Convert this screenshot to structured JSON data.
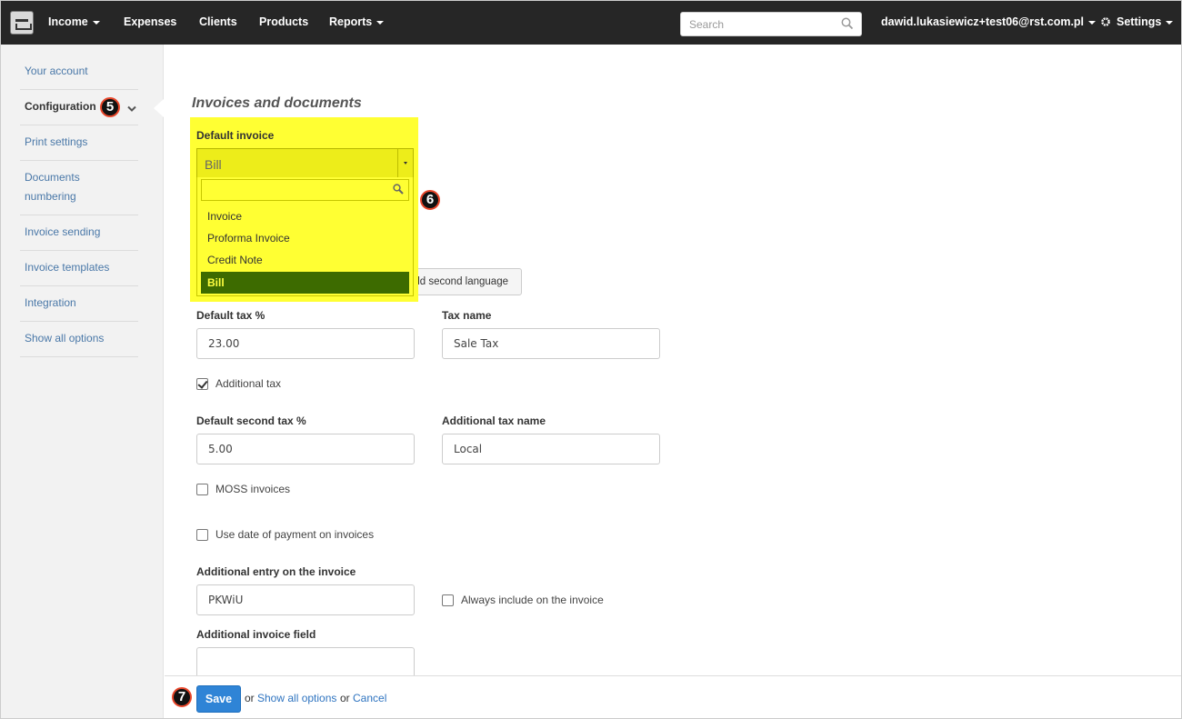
{
  "topnav": {
    "items": [
      {
        "label": "Income",
        "dropdown": true
      },
      {
        "label": "Expenses",
        "dropdown": false
      },
      {
        "label": "Clients",
        "dropdown": false
      },
      {
        "label": "Products",
        "dropdown": false
      },
      {
        "label": "Reports",
        "dropdown": true
      }
    ],
    "search_placeholder": "Search",
    "user_email": "dawid.lukasiewicz+test06@rst.com.pl",
    "settings_label": "Settings"
  },
  "sidebar": {
    "items": [
      {
        "label": "Your account"
      },
      {
        "label": "Configuration"
      },
      {
        "label": "Print settings"
      },
      {
        "label": "Documents numbering"
      },
      {
        "label": "Invoice sending"
      },
      {
        "label": "Invoice templates"
      },
      {
        "label": "Integration"
      },
      {
        "label": "Show all options"
      }
    ],
    "active": "Configuration"
  },
  "badges": {
    "five": "5",
    "six": "6",
    "seven": "7"
  },
  "main": {
    "section_title": "Invoices and documents",
    "default_invoice": {
      "label": "Default invoice",
      "selected": "Bill",
      "options": [
        "Invoice",
        "Proforma Invoice",
        "Credit Note",
        "Bill"
      ]
    },
    "add_language_label": "Add second language",
    "default_tax": {
      "label": "Default tax %",
      "value": "23.00"
    },
    "tax_name": {
      "label": "Tax name",
      "value": "Sale Tax"
    },
    "additional_tax": {
      "label": "Additional tax",
      "checked": true
    },
    "default_second_tax": {
      "label": "Default second tax %",
      "value": "5.00"
    },
    "additional_tax_name": {
      "label": "Additional tax name",
      "value": "Local"
    },
    "moss": {
      "label": "MOSS invoices",
      "checked": false
    },
    "use_payment_date": {
      "label": "Use date of payment on invoices",
      "checked": false
    },
    "additional_entry": {
      "label": "Additional entry on the invoice",
      "value": "PKWiU"
    },
    "always_include": {
      "label": "Always include on the invoice",
      "checked": false
    },
    "additional_field": {
      "label": "Additional invoice field",
      "value": ""
    }
  },
  "footer": {
    "save_label": "Save",
    "or1": "or",
    "show_all_label": "Show all options",
    "or2": "or",
    "cancel_label": "Cancel"
  },
  "colors": {
    "highlight": "#ffff33",
    "selected_option_bg": "#3d6b00",
    "link": "#4a78a8",
    "save_button": "#2f84d6",
    "topbar": "#262626"
  }
}
